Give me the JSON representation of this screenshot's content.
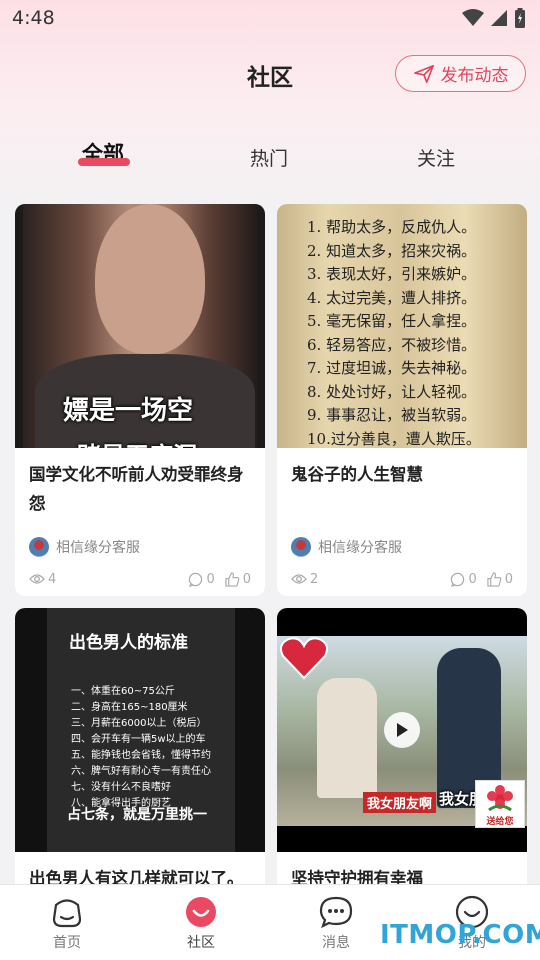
{
  "status_bar": {
    "time": "4:48"
  },
  "header": {
    "title": "社区",
    "publish_label": "发布动态"
  },
  "tabs": [
    {
      "label": "全部",
      "active": true
    },
    {
      "label": "热门",
      "active": false
    },
    {
      "label": "关注",
      "active": false
    }
  ],
  "cards": [
    {
      "title": "国学文化不听前人劝受罪终身怨",
      "author": "相信缘分客服",
      "views": "4",
      "comments": "0",
      "likes": "0",
      "image_caption": "嫖是一场空",
      "image_caption2": "赌是无底洞"
    },
    {
      "title": "鬼谷子的人生智慧",
      "author": "相信缘分客服",
      "views": "2",
      "comments": "0",
      "likes": "0",
      "image_lines": [
        "1. 帮助太多，反成仇人。",
        "2. 知道太多，招来灾祸。",
        "3. 表现太好，引来嫉妒。",
        "4. 太过完美，遭人排挤。",
        "5. 毫无保留，任人拿捏。",
        "6. 轻易答应，不被珍惜。",
        "7. 过度坦诚，失去神秘。",
        "8. 处处讨好，让人轻视。",
        "9. 事事忍让，被当软弱。",
        "10.过分善良，遭人欺压。"
      ]
    },
    {
      "title": "出色男人有这几样就可以了。",
      "image_heading": "出色男人的标准",
      "image_lines": [
        "一、体重在60~75公斤",
        "二、身高在165~180厘米",
        "三、月薪在6000以上（税后）",
        "四、会开车有一辆5w以上的车",
        "五、能挣钱也会省钱，懂得节约",
        "六、脾气好有耐心专一有责任心",
        "七、没有什么不良嗜好",
        "八、能拿得出手的厨艺"
      ],
      "image_footer": "占七条，就是万里挑一"
    },
    {
      "title": "坚持守护拥有幸福",
      "image_caption": "我女朋友啊",
      "image_caption2": "我女朋",
      "image_logo_text": "送给您"
    }
  ],
  "bottom_nav": [
    {
      "label": "首页",
      "icon": "home-face-icon",
      "active": false
    },
    {
      "label": "社区",
      "icon": "community-smile-icon",
      "active": true
    },
    {
      "label": "消息",
      "icon": "message-bubble-icon",
      "active": false
    },
    {
      "label": "我的",
      "icon": "profile-smile-icon",
      "active": false
    }
  ],
  "watermark": "ITMOP.COM",
  "colors": {
    "accent": "#e94a62",
    "publish_border": "#e8707f",
    "watermark": "#2fa5d8"
  }
}
